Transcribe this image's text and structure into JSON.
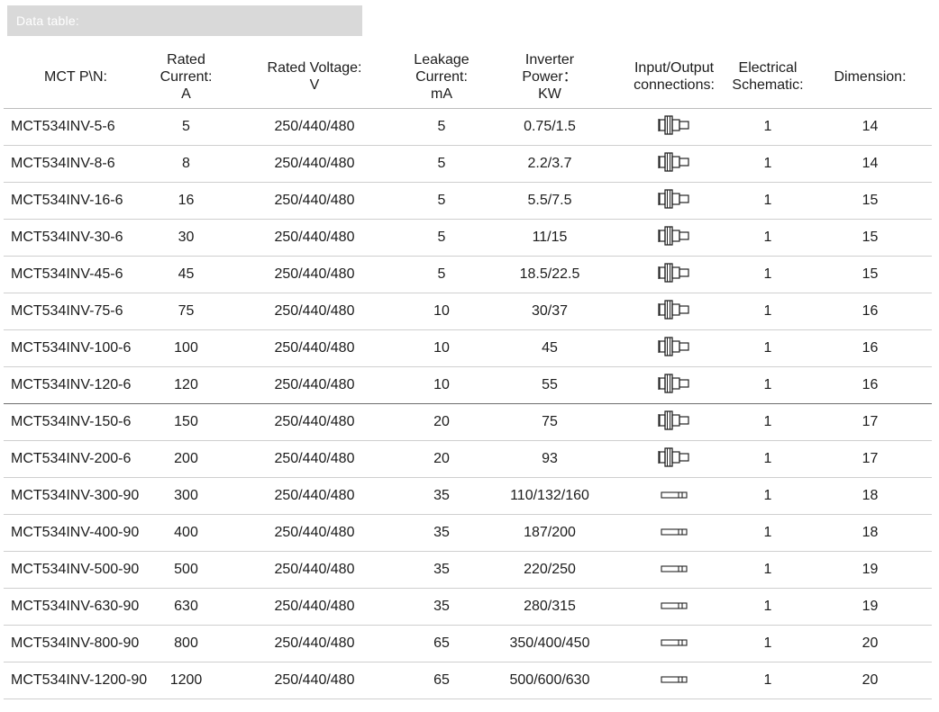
{
  "banner": {
    "title": "Data table:"
  },
  "headers": [
    [
      "MCT P\\N:"
    ],
    [
      "Rated Current:",
      "A"
    ],
    [
      "Rated Voltage:",
      "V"
    ],
    [
      "Leakage",
      "Current:",
      "mA"
    ],
    [
      "Inverter",
      "Power：",
      "KW"
    ],
    [
      "Input/Output",
      "connections:"
    ],
    [
      "Electrical",
      "Schematic:"
    ],
    [
      "Dimension:"
    ]
  ],
  "rows": [
    {
      "pn": "MCT534INV-5-6",
      "current": "5",
      "voltage": "250/440/480",
      "leakage": "5",
      "power": "0.75/1.5",
      "connection": "terminal-block-icon",
      "schematic": "1",
      "dimension": "14"
    },
    {
      "pn": "MCT534INV-8-6",
      "current": "8",
      "voltage": "250/440/480",
      "leakage": "5",
      "power": "2.2/3.7",
      "connection": "terminal-block-icon",
      "schematic": "1",
      "dimension": "14"
    },
    {
      "pn": "MCT534INV-16-6",
      "current": "16",
      "voltage": "250/440/480",
      "leakage": "5",
      "power": "5.5/7.5",
      "connection": "terminal-block-icon",
      "schematic": "1",
      "dimension": "15"
    },
    {
      "pn": "MCT534INV-30-6",
      "current": "30",
      "voltage": "250/440/480",
      "leakage": "5",
      "power": "11/15",
      "connection": "terminal-block-icon",
      "schematic": "1",
      "dimension": "15"
    },
    {
      "pn": "MCT534INV-45-6",
      "current": "45",
      "voltage": "250/440/480",
      "leakage": "5",
      "power": "18.5/22.5",
      "connection": "terminal-block-icon",
      "schematic": "1",
      "dimension": "15"
    },
    {
      "pn": "MCT534INV-75-6",
      "current": "75",
      "voltage": "250/440/480",
      "leakage": "10",
      "power": "30/37",
      "connection": "terminal-block-icon",
      "schematic": "1",
      "dimension": "16"
    },
    {
      "pn": "MCT534INV-100-6",
      "current": "100",
      "voltage": "250/440/480",
      "leakage": "10",
      "power": "45",
      "connection": "terminal-block-icon",
      "schematic": "1",
      "dimension": "16"
    },
    {
      "pn": "MCT534INV-120-6",
      "current": "120",
      "voltage": "250/440/480",
      "leakage": "10",
      "power": "55",
      "connection": "terminal-block-icon",
      "schematic": "1",
      "dimension": "16"
    },
    {
      "pn": "MCT534INV-150-6",
      "current": "150",
      "voltage": "250/440/480",
      "leakage": "20",
      "power": "75",
      "connection": "terminal-block-icon",
      "schematic": "1",
      "dimension": "17"
    },
    {
      "pn": "MCT534INV-200-6",
      "current": "200",
      "voltage": "250/440/480",
      "leakage": "20",
      "power": "93",
      "connection": "terminal-block-icon",
      "schematic": "1",
      "dimension": "17"
    },
    {
      "pn": "MCT534INV-300-90",
      "current": "300",
      "voltage": "250/440/480",
      "leakage": "35",
      "power": "110/132/160",
      "connection": "busbar-icon",
      "schematic": "1",
      "dimension": "18"
    },
    {
      "pn": "MCT534INV-400-90",
      "current": "400",
      "voltage": "250/440/480",
      "leakage": "35",
      "power": "187/200",
      "connection": "busbar-icon",
      "schematic": "1",
      "dimension": "18"
    },
    {
      "pn": "MCT534INV-500-90",
      "current": "500",
      "voltage": "250/440/480",
      "leakage": "35",
      "power": "220/250",
      "connection": "busbar-icon",
      "schematic": "1",
      "dimension": "19"
    },
    {
      "pn": "MCT534INV-630-90",
      "current": "630",
      "voltage": "250/440/480",
      "leakage": "35",
      "power": "280/315",
      "connection": "busbar-icon",
      "schematic": "1",
      "dimension": "19"
    },
    {
      "pn": "MCT534INV-800-90",
      "current": "800",
      "voltage": "250/440/480",
      "leakage": "65",
      "power": "350/400/450",
      "connection": "busbar-icon",
      "schematic": "1",
      "dimension": "20"
    },
    {
      "pn": "MCT534INV-1200-90",
      "current": "1200",
      "voltage": "250/440/480",
      "leakage": "65",
      "power": "500/600/630",
      "connection": "busbar-icon",
      "schematic": "1",
      "dimension": "20"
    }
  ]
}
